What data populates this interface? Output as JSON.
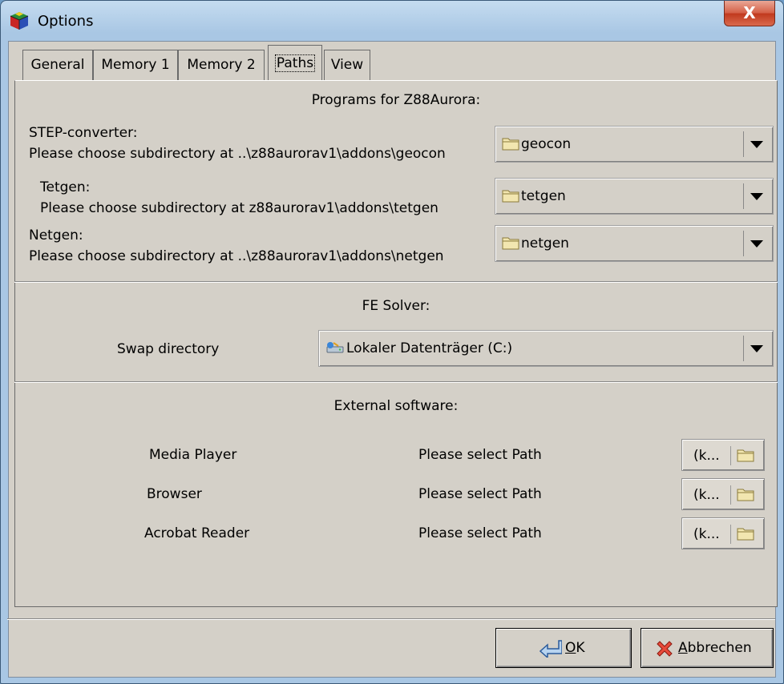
{
  "window": {
    "title": "Options",
    "close_glyph": "X"
  },
  "tabs": [
    {
      "label": "General"
    },
    {
      "label": "Memory 1"
    },
    {
      "label": "Memory 2"
    },
    {
      "label": "Paths"
    },
    {
      "label": "View"
    }
  ],
  "programs": {
    "header": "Programs for Z88Aurora:",
    "step": {
      "name": "STEP-converter:",
      "hint": "Please choose subdirectory at ..\\z88aurorav1\\addons\\geocon",
      "value": "geocon"
    },
    "tetgen": {
      "name": "Tetgen:",
      "hint": "Please choose subdirectory at z88aurorav1\\addons\\tetgen",
      "value": "tetgen"
    },
    "netgen": {
      "name": "Netgen:",
      "hint": "Please choose subdirectory at ..\\z88aurorav1\\addons\\netgen",
      "value": "netgen"
    }
  },
  "solver": {
    "header": "FE Solver:",
    "swap_label": "Swap directory",
    "swap_value": "Lokaler Datenträger (C:)"
  },
  "external": {
    "header": "External software:",
    "items": [
      {
        "name": "Media Player",
        "path": "Please select Path",
        "button": "(k..."
      },
      {
        "name": "Browser",
        "path": "Please select Path",
        "button": "(k..."
      },
      {
        "name": "Acrobat Reader",
        "path": "Please select Path",
        "button": "(k..."
      }
    ]
  },
  "buttons": {
    "ok_mnemonic": "O",
    "ok_rest": "K",
    "cancel_mnemonic": "A",
    "cancel_rest": "bbrechen"
  }
}
